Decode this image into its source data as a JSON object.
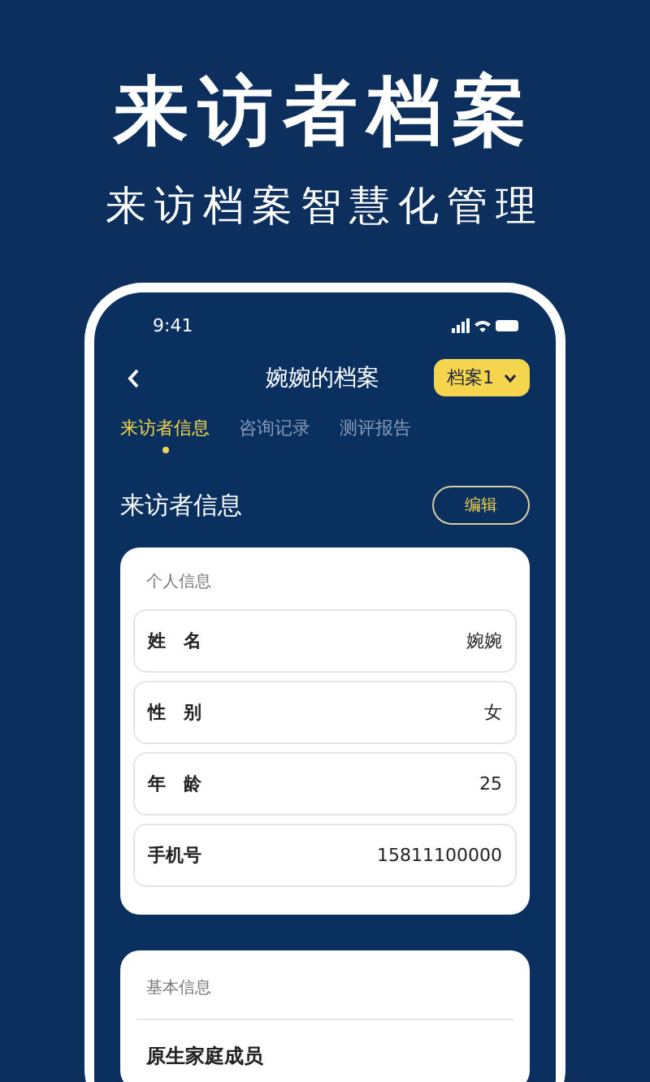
{
  "headline": "来访者档案",
  "subheadline": "来访档案智慧化管理",
  "status_bar": {
    "time": "9:41"
  },
  "nav": {
    "title": "婉婉的档案",
    "file_dropdown": "档案1"
  },
  "tabs": [
    {
      "label": "来访者信息",
      "selected": true
    },
    {
      "label": "咨询记录",
      "selected": false
    },
    {
      "label": "测评报告",
      "selected": false
    }
  ],
  "section": {
    "title": "来访者信息",
    "edit_button": "编辑"
  },
  "personal_card": {
    "title": "个人信息",
    "rows": [
      {
        "label": "姓名",
        "value": "婉婉"
      },
      {
        "label": "性别",
        "value": "女"
      },
      {
        "label": "年龄",
        "value": "25"
      },
      {
        "label": "手机号",
        "value": "15811100000"
      }
    ]
  },
  "basic_card": {
    "title": "基本信息",
    "rows": [
      {
        "label": "原生家庭成员"
      }
    ]
  }
}
